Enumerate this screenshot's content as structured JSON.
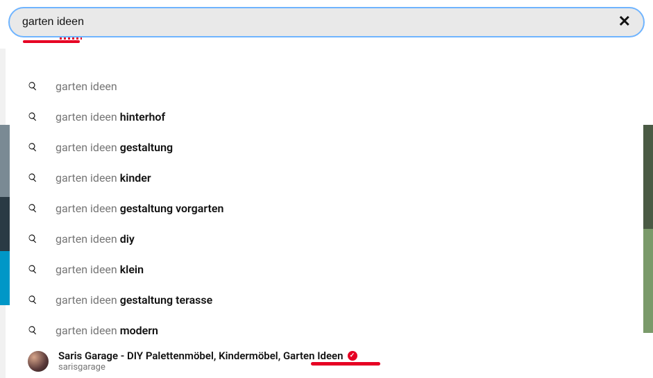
{
  "search": {
    "value": "garten ideen",
    "clear_symbol": "✕"
  },
  "suggestions": [
    {
      "prefix": "garten ideen",
      "suffix": ""
    },
    {
      "prefix": "garten ideen ",
      "suffix": "hinterhof"
    },
    {
      "prefix": "garten ideen ",
      "suffix": "gestaltung"
    },
    {
      "prefix": "garten ideen ",
      "suffix": "kinder"
    },
    {
      "prefix": "garten ideen ",
      "suffix": "gestaltung vorgarten"
    },
    {
      "prefix": "garten ideen ",
      "suffix": "diy"
    },
    {
      "prefix": "garten ideen ",
      "suffix": "klein"
    },
    {
      "prefix": "garten ideen ",
      "suffix": "gestaltung terasse"
    },
    {
      "prefix": "garten ideen ",
      "suffix": "modern"
    }
  ],
  "profile": {
    "title": "Saris Garage - DIY Palettenmöbel, Kindermöbel, Garten Ideen",
    "handle": "sarisgarage"
  }
}
